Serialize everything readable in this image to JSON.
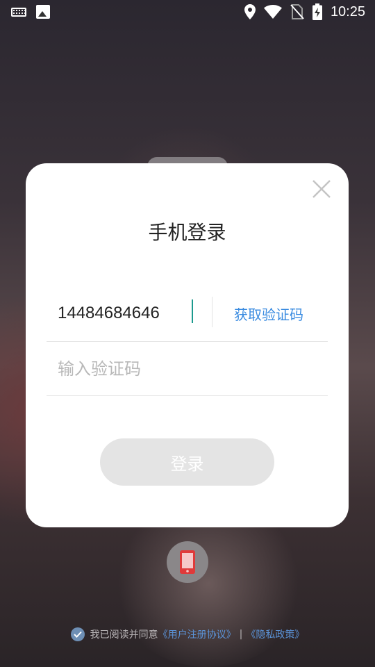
{
  "status_bar": {
    "time": "10:25",
    "left_icons": [
      "keyboard-icon",
      "image-icon"
    ],
    "right_icons": [
      "location-icon",
      "wifi-icon",
      "no-sim-icon",
      "battery-charging-icon"
    ]
  },
  "dialog": {
    "title": "手机登录",
    "phone": {
      "value": "14484684646"
    },
    "get_code_label": "获取验证码",
    "code": {
      "placeholder": "输入验证码"
    },
    "login_label": "登录"
  },
  "agreement": {
    "text": "我已阅读并同意",
    "user_agreement": "《用户注册协议》",
    "separator": "|",
    "privacy_policy": "《隐私政策》"
  },
  "colors": {
    "accent": "#3a8be0",
    "caret": "#1c9a8e",
    "login_disabled": "#e4e4e4",
    "phone_icon": "#e03a3a"
  }
}
